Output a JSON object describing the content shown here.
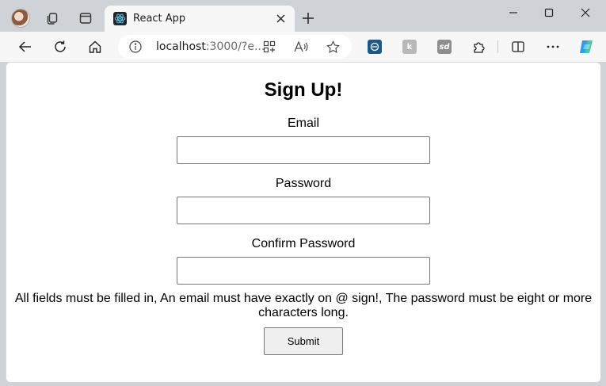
{
  "browser": {
    "tab": {
      "title": "React App"
    },
    "address": {
      "host": "localhost",
      "rest": ":3000/?e..."
    }
  },
  "form": {
    "heading": "Sign Up!",
    "email": {
      "label": "Email",
      "value": ""
    },
    "password": {
      "label": "Password",
      "value": ""
    },
    "confirm": {
      "label": "Confirm Password",
      "value": ""
    },
    "error_text": "All fields must be filled in, An email must have exactly on @ sign!, The password must be eight or more characters long.",
    "submit_label": "Submit"
  },
  "icons": {
    "extension_a": "edge-extension-blue",
    "extension_b": "edge-extension-k",
    "extension_c": "edge-extension-sd"
  },
  "colors": {
    "chrome": "#cfd3d8",
    "toolbar": "#f7f7f7",
    "copilot": "#2d9cf0"
  }
}
